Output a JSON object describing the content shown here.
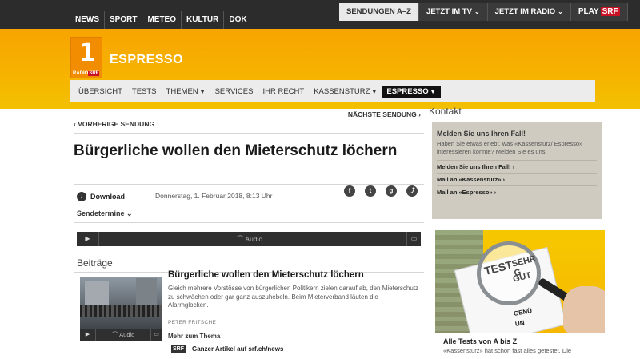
{
  "top_nav": [
    "NEWS",
    "SPORT",
    "METEO",
    "KULTUR",
    "DOK"
  ],
  "right_nav": {
    "sendungen": "SENDUNGEN A–Z",
    "tv": "JETZT IM TV",
    "radio": "JETZT IM RADIO",
    "play": "PLAY",
    "play_srf": "SRF"
  },
  "logo": {
    "number": "1",
    "radio": "RADIO",
    "srf": "SRF"
  },
  "site_title": "ESPRESSO",
  "sub_nav": [
    "ÜBERSICHT",
    "TESTS",
    "THEMEN",
    "SERVICES",
    "IHR RECHT",
    "KASSENSTURZ",
    "ESPRESSO"
  ],
  "article": {
    "prev": "‹ VORHERIGE SENDUNG",
    "next": "NÄCHSTE SENDUNG ›",
    "title": "Bürgerliche wollen den Mieterschutz löchern",
    "download": "Download",
    "date": "Donnerstag, 1. Februar 2018, 8:13 Uhr",
    "sendetermine": "Sendetermine",
    "audio": "Audio"
  },
  "beitraege": {
    "heading": "Beiträge",
    "story_title": "Bürgerliche wollen den Mieterschutz löchern",
    "story_text": "Gleich mehrere Vorstösse von bürgerlichen Politikern zielen darauf ab, den Mieterschutz zu schwächen oder gar ganz auszuhebeln. Beim Mieterverband läuten die Alarmglocken.",
    "author": "PETER FRITSCHE",
    "audio": "Audio",
    "more": "Mehr zum Thema",
    "srf_badge": "SRF",
    "link": "Ganzer Artikel auf srf.ch/news"
  },
  "sidebar": {
    "kontakt": "Kontakt",
    "box_title": "Melden Sie uns Ihren Fall!",
    "box_text": "Haben Sie etwas erlebt, was «Kassensturz/ Espresso» interessieren könnte? Melden Sie es uns!",
    "links": [
      "Melden Sie uns Ihren Fall! ›",
      "Mail an «Kassensturz» ›",
      "Mail an «Espresso» ›"
    ],
    "tests_image": {
      "test": "TEST",
      "sehr": "SEHR G",
      "gut": "GUT",
      "genug": "GENÜ",
      "ungenug": "UN"
    },
    "tests_title": "Alle Tests von A bis Z",
    "tests_text": "«Kassensturz» hat schon fast alles getestet. Die"
  }
}
